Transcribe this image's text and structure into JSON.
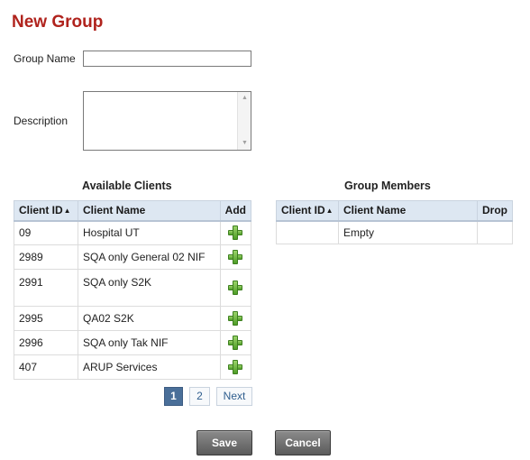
{
  "page_title": "New Group",
  "form": {
    "group_name_label": "Group Name",
    "group_name_value": "",
    "description_label": "Description",
    "description_value": ""
  },
  "available_clients": {
    "title": "Available Clients",
    "columns": {
      "client_id": "Client ID",
      "client_name": "Client Name",
      "add": "Add"
    },
    "rows": [
      {
        "id": "09",
        "name": "Hospital UT"
      },
      {
        "id": "2989",
        "name": "SQA only General 02 NIF"
      },
      {
        "id": "2991",
        "name": "SQA only S2K"
      },
      {
        "id": "2995",
        "name": "QA02 S2K"
      },
      {
        "id": "2996",
        "name": "SQA only Tak NIF"
      },
      {
        "id": "407",
        "name": "ARUP Services"
      }
    ],
    "add_icon": "plus-icon",
    "sort_icon": "sort-ascending-icon"
  },
  "group_members": {
    "title": "Group Members",
    "columns": {
      "client_id": "Client ID",
      "client_name": "Client Name",
      "drop": "Drop"
    },
    "empty_text": "Empty"
  },
  "pagination": {
    "pages": [
      "1",
      "2"
    ],
    "current": "1",
    "next_label": "Next"
  },
  "buttons": {
    "save": "Save",
    "cancel": "Cancel"
  },
  "colors": {
    "title": "#b0231d",
    "header_bg": "#dde7f2",
    "active_page": "#4a6f99",
    "button_bg": "#6e6e6e",
    "add_icon": "#5aa832"
  }
}
